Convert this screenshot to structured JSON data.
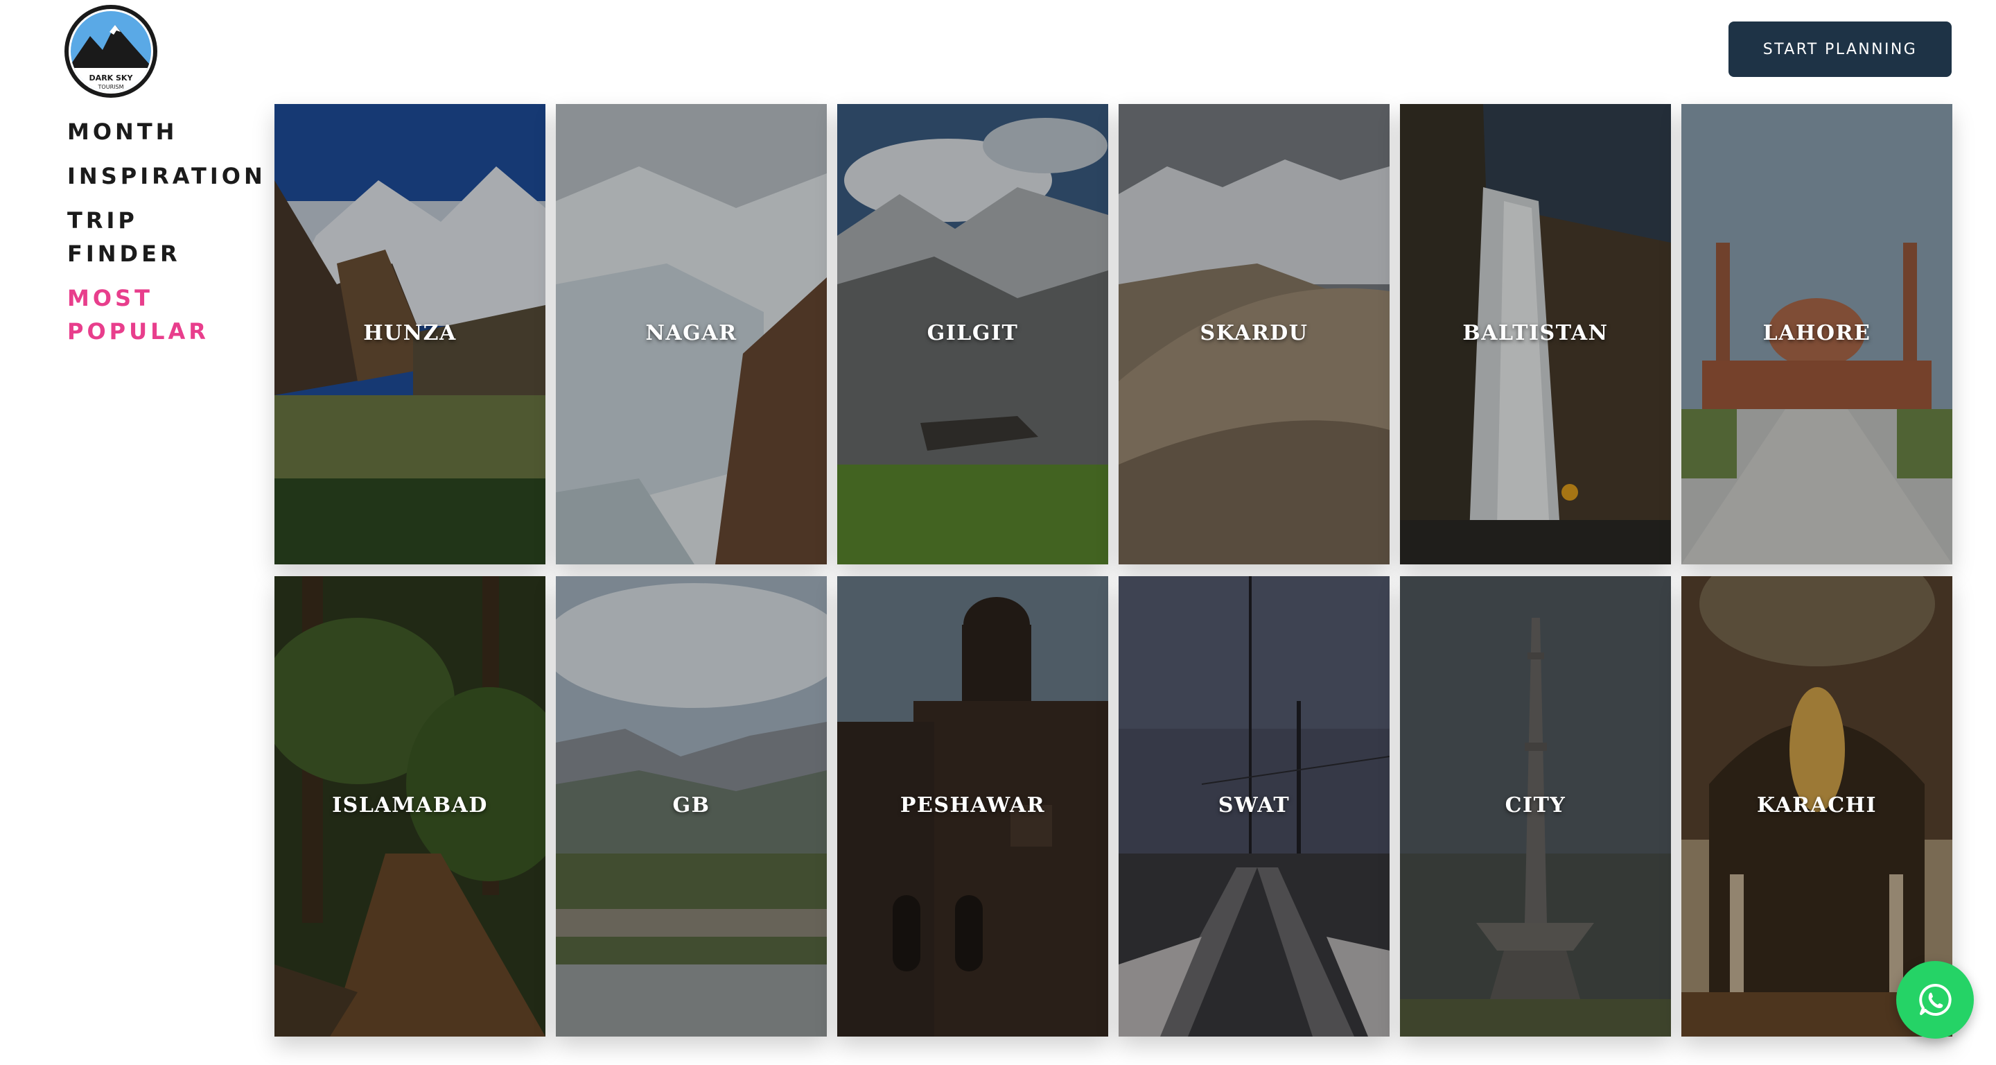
{
  "logo": {
    "text_top": "DARK SKY",
    "text_bottom": "TOURISM"
  },
  "nav": {
    "items": [
      {
        "label": "MONTH",
        "active": false
      },
      {
        "label": "INSPIRATION",
        "active": false
      },
      {
        "label": "TRIP FINDER",
        "active": false
      },
      {
        "label": "MOST POPULAR",
        "active": true
      }
    ]
  },
  "header": {
    "cta_label": "START PLANNING"
  },
  "destinations": [
    {
      "label": "HUNZA"
    },
    {
      "label": "NAGAR"
    },
    {
      "label": "GILGIT"
    },
    {
      "label": "SKARDU"
    },
    {
      "label": "BALTISTAN"
    },
    {
      "label": "LAHORE"
    },
    {
      "label": "ISLAMABAD"
    },
    {
      "label": "GB"
    },
    {
      "label": "PESHAWAR"
    },
    {
      "label": "SWAT"
    },
    {
      "label": "CITY"
    },
    {
      "label": "KARACHI"
    }
  ],
  "colors": {
    "accent": "#e83e8c",
    "cta": "#1e3346",
    "whatsapp": "#25d366"
  },
  "icons": {
    "chat": "whatsapp-icon"
  }
}
